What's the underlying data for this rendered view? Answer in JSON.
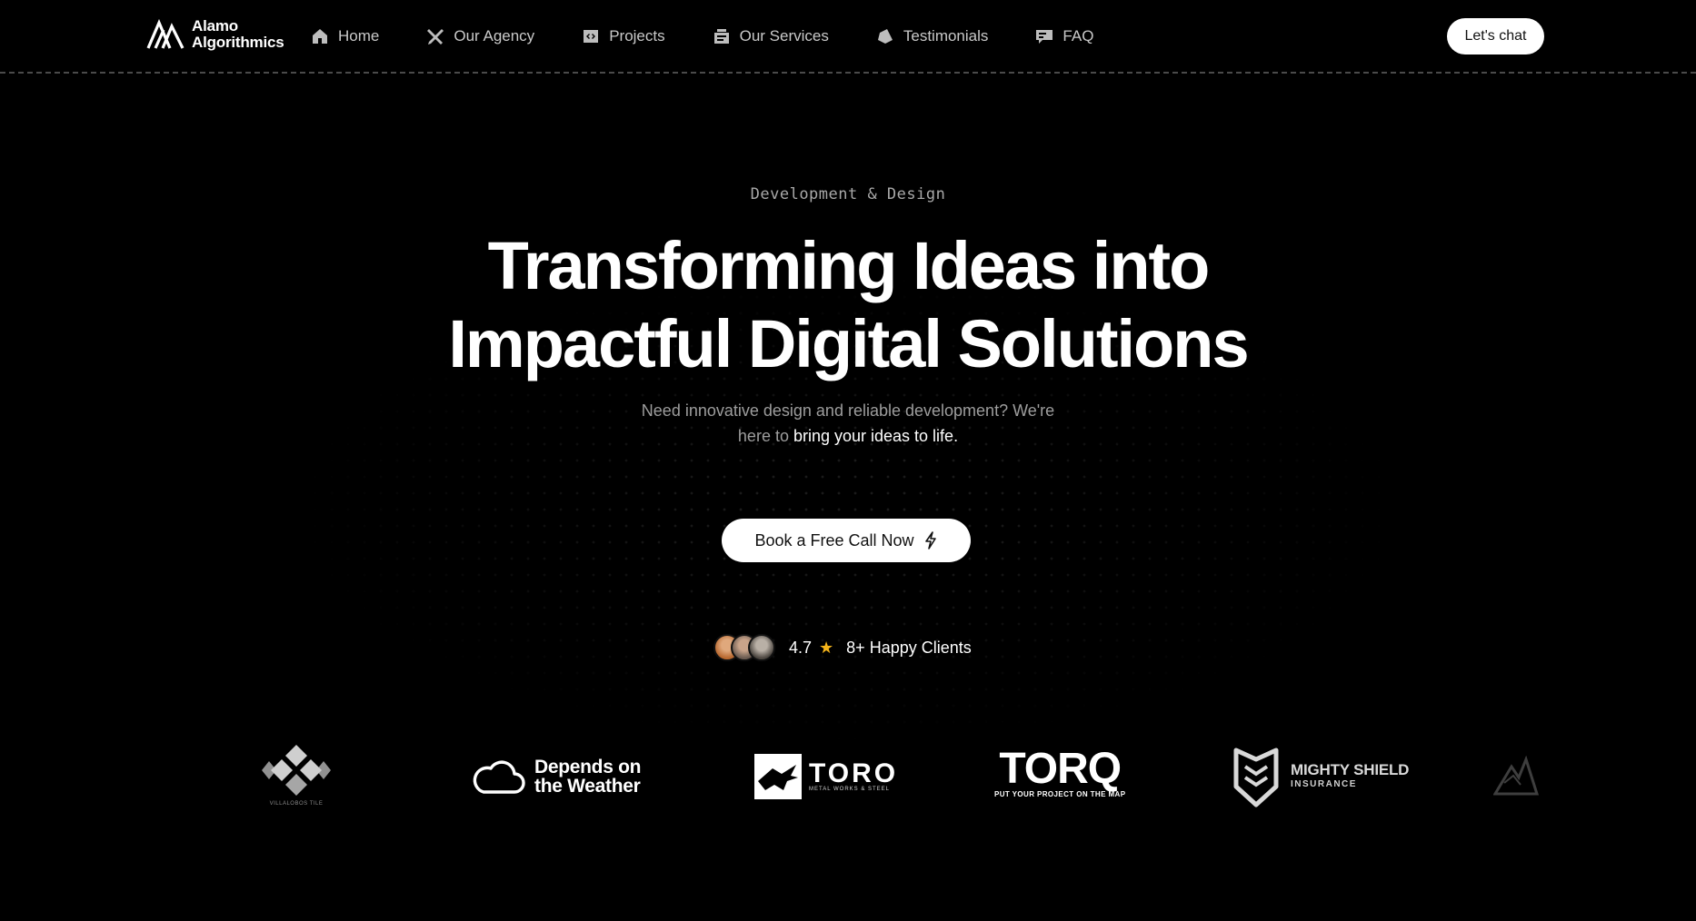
{
  "brand": {
    "name_line1": "Alamo",
    "name_line2": "Algorithmics"
  },
  "nav": {
    "items": [
      {
        "label": "Home",
        "icon": "home-icon"
      },
      {
        "label": "Our Agency",
        "icon": "tools-icon"
      },
      {
        "label": "Projects",
        "icon": "code-icon"
      },
      {
        "label": "Our Services",
        "icon": "services-icon"
      },
      {
        "label": "Testimonials",
        "icon": "testimonial-icon"
      },
      {
        "label": "FAQ",
        "icon": "faq-icon"
      }
    ],
    "cta_label": "Let's chat"
  },
  "hero": {
    "eyebrow": "Development & Design",
    "headline_line1": "Transforming Ideas into",
    "headline_line2": "Impactful Digital Solutions",
    "sub_line1": "Need innovative design and reliable development? We're",
    "sub_line2_prefix": "here to ",
    "sub_line2_emphasis": "bring your ideas to life.",
    "cta_label": "Book a Free Call Now"
  },
  "social_proof": {
    "rating": "4.7",
    "clients": "8+ Happy Clients"
  },
  "client_logos": {
    "villa_caption": "VILLALOBOS TILE",
    "weather_line1": "Depends on",
    "weather_line2": "the Weather",
    "toro_name": "TORO",
    "toro_sub": "METAL WORKS & STEEL",
    "torq_name": "TORQ",
    "torq_sub": "PUT YOUR PROJECT ON THE MAP",
    "shield_name": "MIGHTY SHIELD",
    "shield_sub": "INSURANCE"
  },
  "colors": {
    "background": "#000000",
    "accent_star": "#f5b41a",
    "button_bg": "#ffffff"
  }
}
